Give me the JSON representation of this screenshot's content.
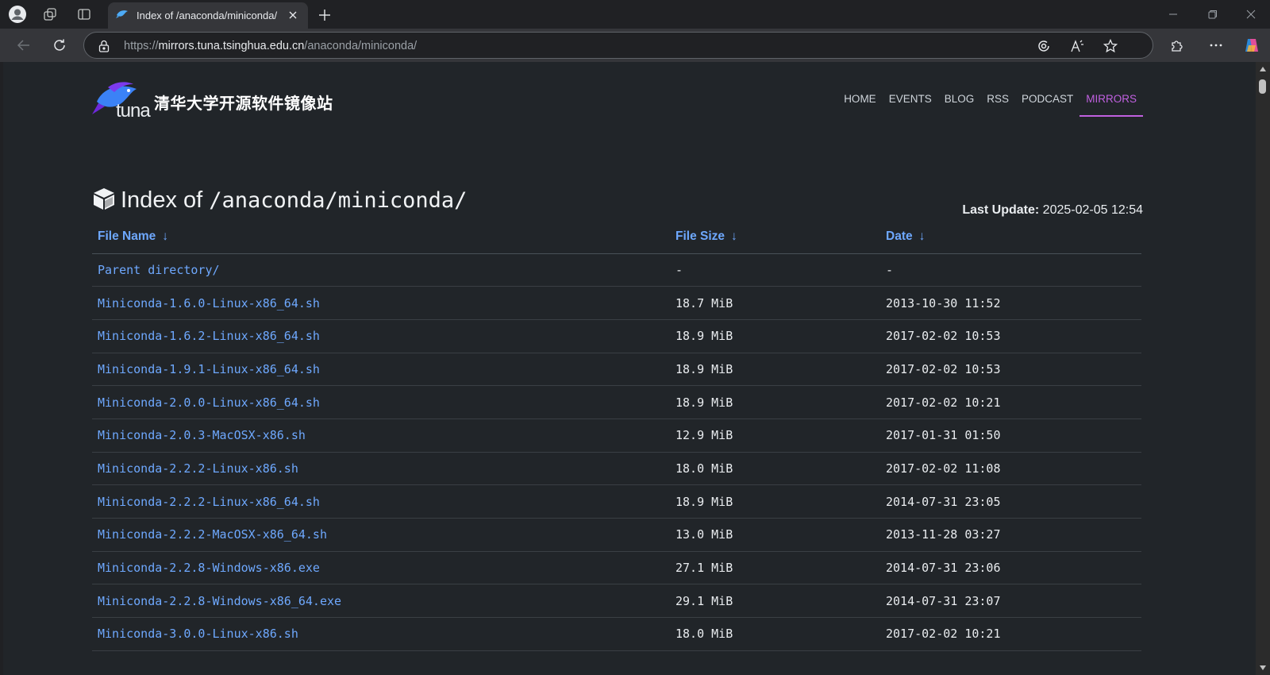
{
  "browser": {
    "tab_title": "Index of /anaconda/miniconda/ |",
    "url_scheme": "https://",
    "url_host": "mirrors.tuna.tsinghua.edu.cn",
    "url_path": "/anaconda/miniconda/"
  },
  "site": {
    "logo_text": "tuna",
    "name": "清华大学开源软件镜像站",
    "nav": [
      {
        "label": "HOME",
        "active": false
      },
      {
        "label": "EVENTS",
        "active": false
      },
      {
        "label": "BLOG",
        "active": false
      },
      {
        "label": "RSS",
        "active": false
      },
      {
        "label": "PODCAST",
        "active": false
      },
      {
        "label": "MIRRORS",
        "active": true
      }
    ],
    "accent_color": "#c060e0",
    "link_color": "#6ea8fe"
  },
  "listing": {
    "title_prefix": "Index of",
    "title_path": "/anaconda/miniconda/",
    "last_update_label": "Last Update:",
    "last_update_value": "2025-02-05 12:54",
    "columns": [
      {
        "label": "File Name",
        "arrow": "↓"
      },
      {
        "label": "File Size",
        "arrow": "↓"
      },
      {
        "label": "Date",
        "arrow": "↓"
      }
    ],
    "rows": [
      {
        "name": "Parent directory/",
        "size": "-",
        "date": "-"
      },
      {
        "name": "Miniconda-1.6.0-Linux-x86_64.sh",
        "size": "18.7 MiB",
        "date": "2013-10-30 11:52"
      },
      {
        "name": "Miniconda-1.6.2-Linux-x86_64.sh",
        "size": "18.9 MiB",
        "date": "2017-02-02 10:53"
      },
      {
        "name": "Miniconda-1.9.1-Linux-x86_64.sh",
        "size": "18.9 MiB",
        "date": "2017-02-02 10:53"
      },
      {
        "name": "Miniconda-2.0.0-Linux-x86_64.sh",
        "size": "18.9 MiB",
        "date": "2017-02-02 10:21"
      },
      {
        "name": "Miniconda-2.0.3-MacOSX-x86.sh",
        "size": "12.9 MiB",
        "date": "2017-01-31 01:50"
      },
      {
        "name": "Miniconda-2.2.2-Linux-x86.sh",
        "size": "18.0 MiB",
        "date": "2017-02-02 11:08"
      },
      {
        "name": "Miniconda-2.2.2-Linux-x86_64.sh",
        "size": "18.9 MiB",
        "date": "2014-07-31 23:05"
      },
      {
        "name": "Miniconda-2.2.2-MacOSX-x86_64.sh",
        "size": "13.0 MiB",
        "date": "2013-11-28 03:27"
      },
      {
        "name": "Miniconda-2.2.8-Windows-x86.exe",
        "size": "27.1 MiB",
        "date": "2014-07-31 23:06"
      },
      {
        "name": "Miniconda-2.2.8-Windows-x86_64.exe",
        "size": "29.1 MiB",
        "date": "2014-07-31 23:07"
      },
      {
        "name": "Miniconda-3.0.0-Linux-x86.sh",
        "size": "18.0 MiB",
        "date": "2017-02-02 10:21"
      }
    ]
  }
}
